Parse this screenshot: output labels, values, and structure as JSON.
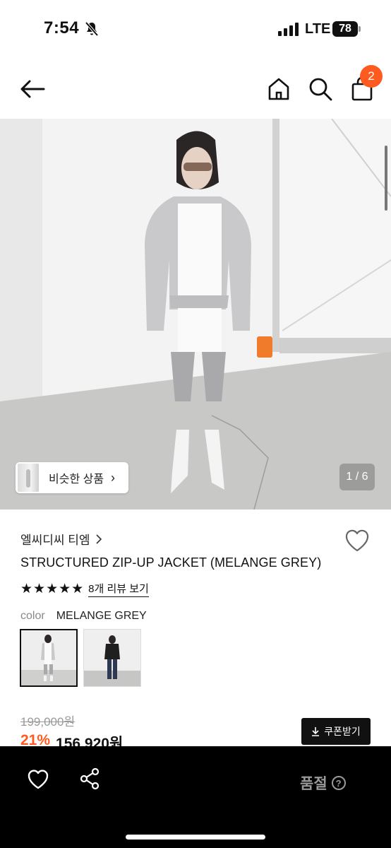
{
  "status_bar": {
    "time": "7:54",
    "network": "LTE",
    "battery": "78"
  },
  "nav": {
    "cart_count": "2"
  },
  "gallery": {
    "similar_label": "비슷한 상품",
    "counter": "1 / 6"
  },
  "product": {
    "brand": "엘씨디씨 티엠",
    "title": "STRUCTURED ZIP-UP JACKET (MELANGE GREY)",
    "stars": "★★★★★",
    "review_link": "8개 리뷰 보기",
    "color_key": "color",
    "color_value": "MELANGE GREY",
    "original_price": "199,000원",
    "discount_pct": "21%",
    "sale_price": "156,920원"
  },
  "coupon": {
    "label": "쿠폰받기"
  },
  "bottom_bar": {
    "status_label": "품절",
    "help_mark": "?"
  },
  "colors": {
    "accent": "#ff5a1f",
    "bar_bg": "#000000",
    "soldout_text": "#9a9a9a"
  }
}
